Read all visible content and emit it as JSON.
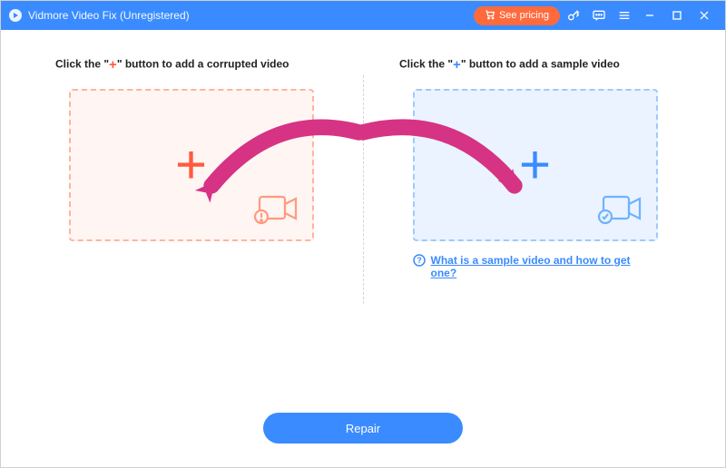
{
  "titlebar": {
    "title": "Vidmore Video Fix (Unregistered)",
    "pricing_label": "See pricing"
  },
  "panels": {
    "left": {
      "label_prefix": "Click the \"",
      "label_plus": "+",
      "label_suffix": "\" button to add a corrupted video"
    },
    "right": {
      "label_prefix": "Click the \"",
      "label_plus": "+",
      "label_suffix": "\" button to add a sample video"
    }
  },
  "help": {
    "link_text": "What is a sample video and how to get one?"
  },
  "footer": {
    "repair_label": "Repair"
  },
  "colors": {
    "accent_blue": "#3a8bff",
    "accent_orange": "#ff6a3d",
    "accent_red": "#ff5a3d",
    "arrow_pink": "#d63384"
  }
}
